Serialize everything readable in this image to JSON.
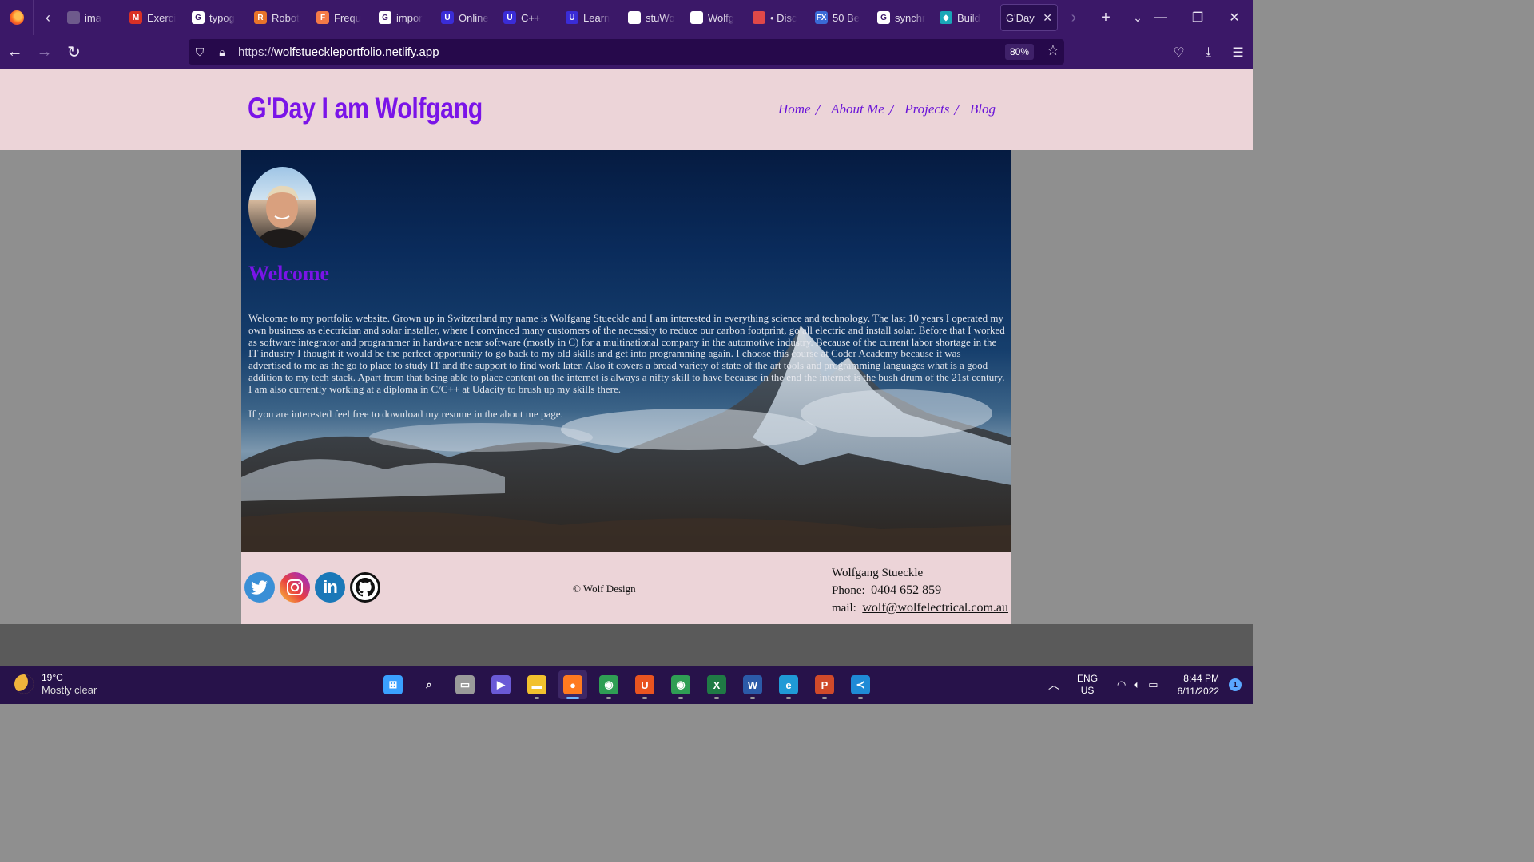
{
  "browser": {
    "tabs": [
      {
        "label": "ima",
        "fav_text": "",
        "fav_color": "#6e5a8c"
      },
      {
        "label": "Exerci",
        "fav_text": "M",
        "fav_color": "#d93025"
      },
      {
        "label": "typog",
        "fav_text": "G",
        "fav_color": "#ffffff"
      },
      {
        "label": "Robot",
        "fav_text": "R",
        "fav_color": "#e8742a"
      },
      {
        "label": "Frequ",
        "fav_text": "F",
        "fav_color": "#f47a47"
      },
      {
        "label": "impor",
        "fav_text": "G",
        "fav_color": "#ffffff"
      },
      {
        "label": "Online",
        "fav_text": "U",
        "fav_color": "#3a2cd6"
      },
      {
        "label": "C++",
        "fav_text": "U",
        "fav_color": "#3a2cd6"
      },
      {
        "label": "Learn",
        "fav_text": "U",
        "fav_color": "#3a2cd6"
      },
      {
        "label": "stuWo",
        "fav_text": "",
        "fav_color": "#ffffff"
      },
      {
        "label": "Wolfg",
        "fav_text": "",
        "fav_color": "#ffffff"
      },
      {
        "label": "• Disc",
        "fav_text": "",
        "fav_color": "#e04848"
      },
      {
        "label": "50 Be",
        "fav_text": "FX",
        "fav_color": "#3a6ad6"
      },
      {
        "label": "synchr",
        "fav_text": "G",
        "fav_color": "#ffffff"
      },
      {
        "label": "Build",
        "fav_text": "◆",
        "fav_color": "#1aa6b7"
      }
    ],
    "active_tab": "G'Day",
    "url_prefix": "https://",
    "url_host": "wolfstueckleportfolio.netlify.app",
    "zoom": "80%"
  },
  "site": {
    "title": "G'Day I am Wolfgang",
    "nav": [
      "Home",
      "About Me",
      "Projects",
      "Blog"
    ],
    "welcome": "Welcome",
    "intro": "Welcome to my portfolio website. Grown up in Switzerland my name is Wolfgang Stueckle and I am interested in everything science and technology. The last 10 years I operated my own business as electrician and solar installer, where I convinced many customers of the necessity to reduce our carbon footprint, go all electric and install solar. Before that I worked as software integrator and programmer in hardware near software (mostly in C) for a multinational company in the automotive industry. Because of the current labor shortage in the IT industry I thought it would be the perfect opportunity to go back to my old skills and get into programming again. I choose this course at Coder Academy because it was advertised to me as the go to place to study IT and the support to find work later. Also it covers a broad variety of state of the art tools and programming languages what is a good addition to my tech stack. Apart from that being able to place content on the internet is always a nifty skill to have because in the end the internet is the bush drum of the 21st century. I am also currently working at a diploma in C/C++ at Udacity to brush up my skills there.",
    "intro2": "If you are interested feel free to download my resume in the about me page.",
    "footer": {
      "copyright": "© Wolf Design",
      "name": "Wolfgang Stueckle",
      "phone_label": "Phone:",
      "phone": "0404 652 859",
      "mail_label": "mail:",
      "email": "wolf@wolfelectrical.com.au",
      "socials": [
        "twitter-icon",
        "instagram-icon",
        "linkedin-icon",
        "github-icon"
      ]
    },
    "colors": {
      "accent": "#7a14e8",
      "header_bg": "#ecd4d8"
    }
  },
  "taskbar": {
    "temperature": "19°C",
    "condition": "Mostly clear",
    "lang_top": "ENG",
    "lang_bottom": "US",
    "time": "8:44 PM",
    "date": "6/11/2022",
    "notifications": "1",
    "apps": [
      {
        "name": "start",
        "glyph": "⊞",
        "color": "#3aa0ff",
        "on": false
      },
      {
        "name": "search",
        "glyph": "⌕",
        "color": "transparent",
        "on": false
      },
      {
        "name": "task-view",
        "glyph": "▭",
        "color": "#9a9a9a",
        "on": false
      },
      {
        "name": "teams-chat",
        "glyph": "▶",
        "color": "#6a5ad6",
        "on": false
      },
      {
        "name": "file-explorer",
        "glyph": "▬",
        "color": "#f2c12e",
        "on": false
      },
      {
        "name": "firefox",
        "glyph": "●",
        "color": "#ff7a1f",
        "on": true
      },
      {
        "name": "chrome",
        "glyph": "◉",
        "color": "#2f9e54",
        "on": false
      },
      {
        "name": "ubuntu",
        "glyph": "U",
        "color": "#e95420",
        "on": false
      },
      {
        "name": "chrome-profile",
        "glyph": "◉",
        "color": "#2f9e54",
        "on": false
      },
      {
        "name": "excel",
        "glyph": "X",
        "color": "#1f7a45",
        "on": false
      },
      {
        "name": "word",
        "glyph": "W",
        "color": "#2b5aa8",
        "on": false
      },
      {
        "name": "edge",
        "glyph": "e",
        "color": "#1f9ad6",
        "on": false
      },
      {
        "name": "powerpoint",
        "glyph": "P",
        "color": "#d04a2a",
        "on": false
      },
      {
        "name": "vscode",
        "glyph": "≺",
        "color": "#1f8ad6",
        "on": false
      }
    ]
  }
}
